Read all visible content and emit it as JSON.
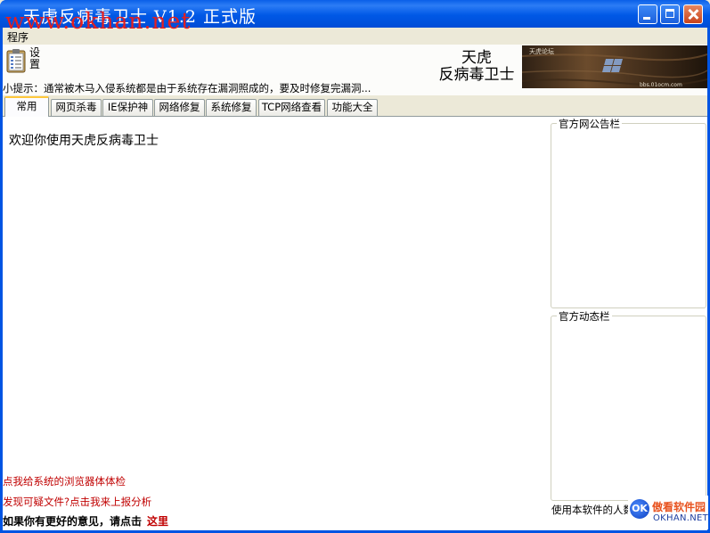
{
  "window": {
    "title": "天虎反病毒卫士 V1.2 正式版",
    "watermark": "www.okhan.net"
  },
  "menu": {
    "program": "程序"
  },
  "toolbar": {
    "settings_label": "设置",
    "brand_line1": "天虎",
    "brand_line2": "反病毒卫士",
    "banner_text": "天虎论坛",
    "banner_url": "bbs.01ocm.com"
  },
  "tip": "小提示：通常被木马入侵系统都是由于系统存在漏洞照成的，要及时修复完漏洞...",
  "tabs": [
    {
      "label": "常用",
      "active": true
    },
    {
      "label": "网页杀毒"
    },
    {
      "label": "IE保护神"
    },
    {
      "label": "网络修复"
    },
    {
      "label": "系统修复"
    },
    {
      "label": "TCP网络查看"
    },
    {
      "label": "功能大全"
    }
  ],
  "main": {
    "welcome": "欢迎你使用天虎反病毒卫士",
    "link_browser_check": "点我给系统的浏览器体体检",
    "link_report_file": "发现可疑文件?点击我来上报分析",
    "feedback_text": "如果你有更好的意见，请点击",
    "feedback_link": "这里"
  },
  "sidebar": {
    "announcement_title": "官方网公告栏",
    "news_title": "官方动态栏",
    "user_count_text": "使用本软件的人数"
  },
  "logo": {
    "mark": "OK",
    "cn": "傲看软件园",
    "en": "OKHAN.NET"
  },
  "colors": {
    "titlebar": "#0054E3",
    "link_red": "#C00000",
    "tab_highlight": "#FFC83C",
    "face": "#ECE9D8"
  }
}
